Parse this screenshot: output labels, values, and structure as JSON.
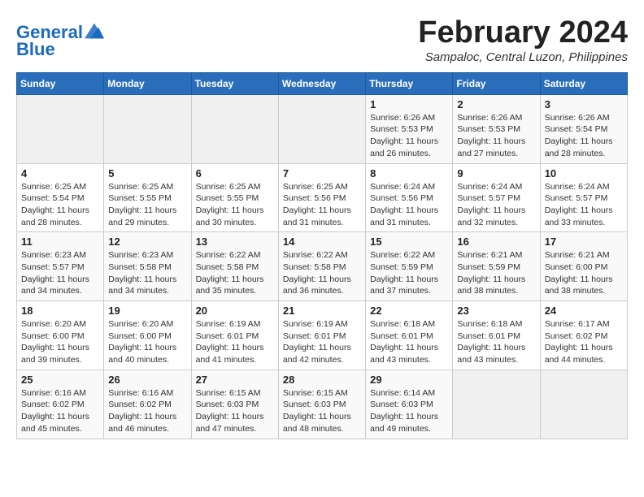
{
  "header": {
    "logo_line1": "General",
    "logo_line2": "Blue",
    "month_year": "February 2024",
    "location": "Sampaloc, Central Luzon, Philippines"
  },
  "weekdays": [
    "Sunday",
    "Monday",
    "Tuesday",
    "Wednesday",
    "Thursday",
    "Friday",
    "Saturday"
  ],
  "weeks": [
    [
      {
        "day": "",
        "info": ""
      },
      {
        "day": "",
        "info": ""
      },
      {
        "day": "",
        "info": ""
      },
      {
        "day": "",
        "info": ""
      },
      {
        "day": "1",
        "info": "Sunrise: 6:26 AM\nSunset: 5:53 PM\nDaylight: 11 hours and 26 minutes."
      },
      {
        "day": "2",
        "info": "Sunrise: 6:26 AM\nSunset: 5:53 PM\nDaylight: 11 hours and 27 minutes."
      },
      {
        "day": "3",
        "info": "Sunrise: 6:26 AM\nSunset: 5:54 PM\nDaylight: 11 hours and 28 minutes."
      }
    ],
    [
      {
        "day": "4",
        "info": "Sunrise: 6:25 AM\nSunset: 5:54 PM\nDaylight: 11 hours and 28 minutes."
      },
      {
        "day": "5",
        "info": "Sunrise: 6:25 AM\nSunset: 5:55 PM\nDaylight: 11 hours and 29 minutes."
      },
      {
        "day": "6",
        "info": "Sunrise: 6:25 AM\nSunset: 5:55 PM\nDaylight: 11 hours and 30 minutes."
      },
      {
        "day": "7",
        "info": "Sunrise: 6:25 AM\nSunset: 5:56 PM\nDaylight: 11 hours and 31 minutes."
      },
      {
        "day": "8",
        "info": "Sunrise: 6:24 AM\nSunset: 5:56 PM\nDaylight: 11 hours and 31 minutes."
      },
      {
        "day": "9",
        "info": "Sunrise: 6:24 AM\nSunset: 5:57 PM\nDaylight: 11 hours and 32 minutes."
      },
      {
        "day": "10",
        "info": "Sunrise: 6:24 AM\nSunset: 5:57 PM\nDaylight: 11 hours and 33 minutes."
      }
    ],
    [
      {
        "day": "11",
        "info": "Sunrise: 6:23 AM\nSunset: 5:57 PM\nDaylight: 11 hours and 34 minutes."
      },
      {
        "day": "12",
        "info": "Sunrise: 6:23 AM\nSunset: 5:58 PM\nDaylight: 11 hours and 34 minutes."
      },
      {
        "day": "13",
        "info": "Sunrise: 6:22 AM\nSunset: 5:58 PM\nDaylight: 11 hours and 35 minutes."
      },
      {
        "day": "14",
        "info": "Sunrise: 6:22 AM\nSunset: 5:58 PM\nDaylight: 11 hours and 36 minutes."
      },
      {
        "day": "15",
        "info": "Sunrise: 6:22 AM\nSunset: 5:59 PM\nDaylight: 11 hours and 37 minutes."
      },
      {
        "day": "16",
        "info": "Sunrise: 6:21 AM\nSunset: 5:59 PM\nDaylight: 11 hours and 38 minutes."
      },
      {
        "day": "17",
        "info": "Sunrise: 6:21 AM\nSunset: 6:00 PM\nDaylight: 11 hours and 38 minutes."
      }
    ],
    [
      {
        "day": "18",
        "info": "Sunrise: 6:20 AM\nSunset: 6:00 PM\nDaylight: 11 hours and 39 minutes."
      },
      {
        "day": "19",
        "info": "Sunrise: 6:20 AM\nSunset: 6:00 PM\nDaylight: 11 hours and 40 minutes."
      },
      {
        "day": "20",
        "info": "Sunrise: 6:19 AM\nSunset: 6:01 PM\nDaylight: 11 hours and 41 minutes."
      },
      {
        "day": "21",
        "info": "Sunrise: 6:19 AM\nSunset: 6:01 PM\nDaylight: 11 hours and 42 minutes."
      },
      {
        "day": "22",
        "info": "Sunrise: 6:18 AM\nSunset: 6:01 PM\nDaylight: 11 hours and 43 minutes."
      },
      {
        "day": "23",
        "info": "Sunrise: 6:18 AM\nSunset: 6:01 PM\nDaylight: 11 hours and 43 minutes."
      },
      {
        "day": "24",
        "info": "Sunrise: 6:17 AM\nSunset: 6:02 PM\nDaylight: 11 hours and 44 minutes."
      }
    ],
    [
      {
        "day": "25",
        "info": "Sunrise: 6:16 AM\nSunset: 6:02 PM\nDaylight: 11 hours and 45 minutes."
      },
      {
        "day": "26",
        "info": "Sunrise: 6:16 AM\nSunset: 6:02 PM\nDaylight: 11 hours and 46 minutes."
      },
      {
        "day": "27",
        "info": "Sunrise: 6:15 AM\nSunset: 6:03 PM\nDaylight: 11 hours and 47 minutes."
      },
      {
        "day": "28",
        "info": "Sunrise: 6:15 AM\nSunset: 6:03 PM\nDaylight: 11 hours and 48 minutes."
      },
      {
        "day": "29",
        "info": "Sunrise: 6:14 AM\nSunset: 6:03 PM\nDaylight: 11 hours and 49 minutes."
      },
      {
        "day": "",
        "info": ""
      },
      {
        "day": "",
        "info": ""
      }
    ]
  ]
}
